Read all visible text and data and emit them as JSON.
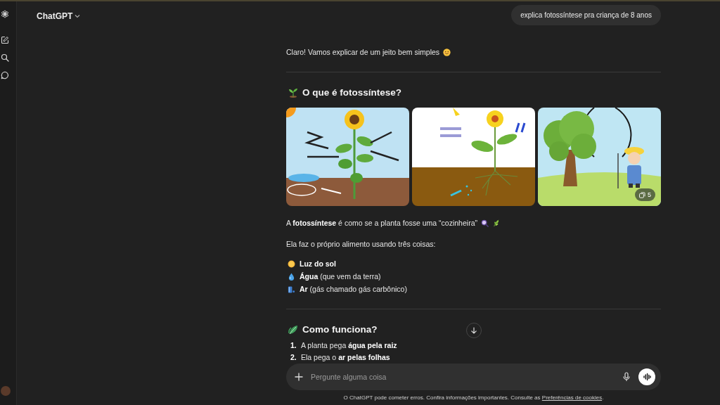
{
  "header": {
    "title": "ChatGPT"
  },
  "user_message": {
    "text": "explica fotossíntese pra criança de 8 anos"
  },
  "response": {
    "intro": "Claro! Vamos explicar de um jeito bem simples",
    "sections": [
      {
        "kind": "overview",
        "heading": "O que é fotossíntese?",
        "gallery": {
          "count": "5"
        },
        "paragraphs": [
          "A **fotossíntese** é como se a planta fosse uma “cozinheira”",
          "Ela faz o próprio alimento usando três coisas:"
        ],
        "items": [
          "**Luz do sol**",
          "**Água** (que vem da terra)",
          "**Ar** (gás chamado gás carbônico)"
        ]
      },
      {
        "kind": "steps",
        "heading": "Como funciona?",
        "steps": [
          {
            "number": "1.",
            "text": "A planta pega **água pela raiz**"
          },
          {
            "number": "2.",
            "text": "Ela pega o **ar pelas folhas**"
          }
        ]
      }
    ]
  },
  "composer": {
    "placeholder": "Pergunte alguma coisa"
  },
  "footer": {
    "text": "O ChatGPT pode cometer erros. Confira informações importantes. Consulte as",
    "link": "Preferências de cookies",
    "end": "."
  }
}
